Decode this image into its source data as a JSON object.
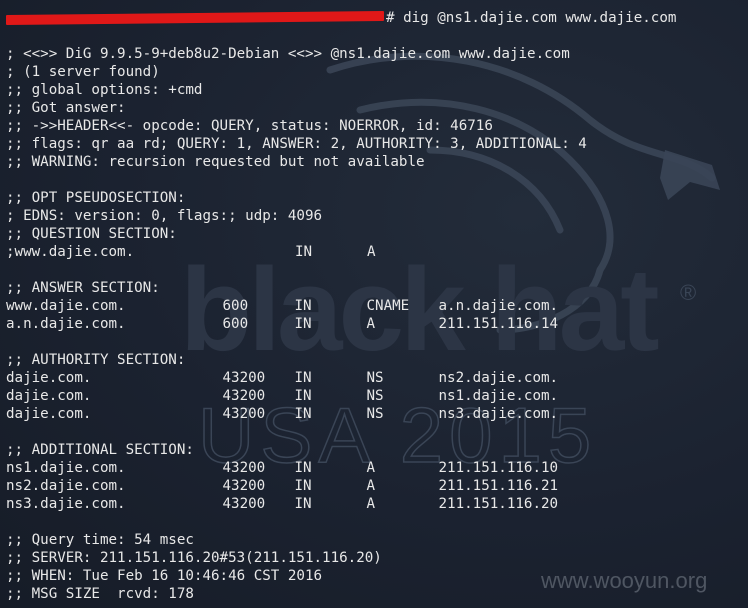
{
  "watermark": {
    "site": "www.wooyun.org"
  },
  "wallpaper": {
    "brand": "black hat",
    "registered": "®",
    "event": "USA 2015"
  },
  "prompt": {
    "command": "# dig @ns1.dajie.com www.dajie.com"
  },
  "header_lines": [
    "; <<>> DiG 9.9.5-9+deb8u2-Debian <<>> @ns1.dajie.com www.dajie.com",
    "; (1 server found)",
    ";; global options: +cmd",
    ";; Got answer:",
    ";; ->>HEADER<<- opcode: QUERY, status: NOERROR, id: 46716",
    ";; flags: qr aa rd; QUERY: 1, ANSWER: 2, AUTHORITY: 3, ADDITIONAL: 4",
    ";; WARNING: recursion requested but not available"
  ],
  "opt_section": {
    "title": ";; OPT PSEUDOSECTION:",
    "edns": "; EDNS: version: 0, flags:; udp: 4096"
  },
  "question_section": {
    "title": ";; QUESTION SECTION:",
    "name": ";www.dajie.com.",
    "class": "IN",
    "type": "A"
  },
  "answer_section": {
    "title": ";; ANSWER SECTION:",
    "records": [
      {
        "name": "www.dajie.com.",
        "ttl": "600",
        "class": "IN",
        "type": "CNAME",
        "data": "a.n.dajie.com."
      },
      {
        "name": "a.n.dajie.com.",
        "ttl": "600",
        "class": "IN",
        "type": "A",
        "data": "211.151.116.14"
      }
    ]
  },
  "authority_section": {
    "title": ";; AUTHORITY SECTION:",
    "records": [
      {
        "name": "dajie.com.",
        "ttl": "43200",
        "class": "IN",
        "type": "NS",
        "data": "ns2.dajie.com."
      },
      {
        "name": "dajie.com.",
        "ttl": "43200",
        "class": "IN",
        "type": "NS",
        "data": "ns1.dajie.com."
      },
      {
        "name": "dajie.com.",
        "ttl": "43200",
        "class": "IN",
        "type": "NS",
        "data": "ns3.dajie.com."
      }
    ]
  },
  "additional_section": {
    "title": ";; ADDITIONAL SECTION:",
    "records": [
      {
        "name": "ns1.dajie.com.",
        "ttl": "43200",
        "class": "IN",
        "type": "A",
        "data": "211.151.116.10"
      },
      {
        "name": "ns2.dajie.com.",
        "ttl": "43200",
        "class": "IN",
        "type": "A",
        "data": "211.151.116.21"
      },
      {
        "name": "ns3.dajie.com.",
        "ttl": "43200",
        "class": "IN",
        "type": "A",
        "data": "211.151.116.20"
      }
    ]
  },
  "footer_lines": [
    ";; Query time: 54 msec",
    ";; SERVER: 211.151.116.20#53(211.151.116.20)",
    ";; WHEN: Tue Feb 16 10:46:46 CST 2016",
    ";; MSG SIZE  rcvd: 178"
  ]
}
